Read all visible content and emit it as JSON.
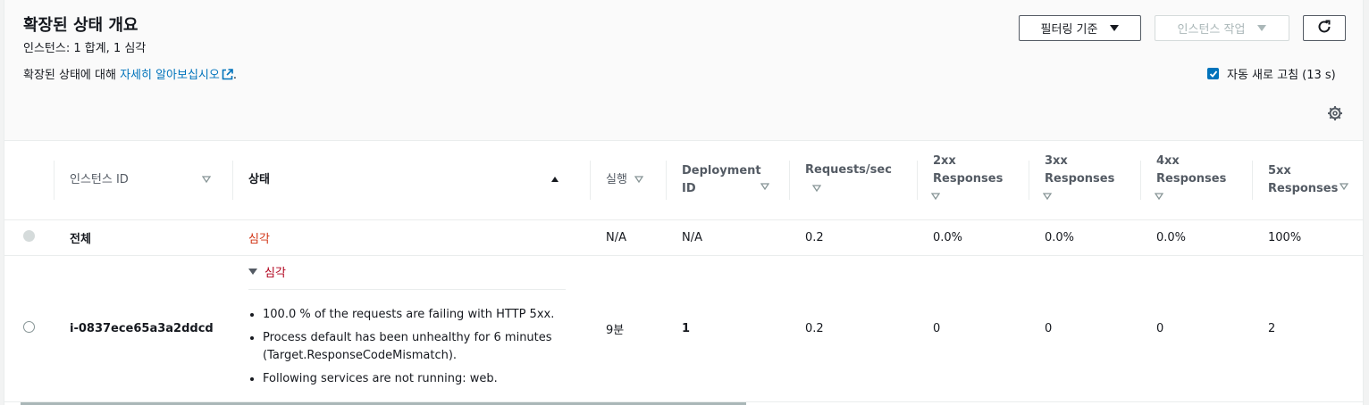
{
  "header": {
    "title": "확장된 상태 개요",
    "counter": "인스턴스: 1 합계, 1 심각",
    "description_prefix": "확장된 상태에 대해 ",
    "learn_more_link": "자세히 알아보십시오",
    "description_suffix": ".",
    "filter_button": "필터링 기준",
    "actions_button": "인스턴스 작업",
    "auto_refresh": "자동 새로 고침 (13 s)"
  },
  "table": {
    "columns": [
      {
        "label": ""
      },
      {
        "label": "인스턴스 ID"
      },
      {
        "label": "상태"
      },
      {
        "label": "실행"
      },
      {
        "label": "Deployment ID"
      },
      {
        "label": "Requests/sec"
      },
      {
        "label": "2xx Responses"
      },
      {
        "label": "3xx Responses"
      },
      {
        "label": "4xx Responses"
      },
      {
        "label": "5xx Responses"
      }
    ],
    "overall": {
      "id": "전체",
      "status": "심각",
      "running": "N/A",
      "deployment": "N/A",
      "rps": "0.2",
      "r2xx": "0.0%",
      "r3xx": "0.0%",
      "r4xx": "0.0%",
      "r5xx": "100%"
    },
    "instance": {
      "id": "i-0837ece65a3a2ddcd",
      "status": "심각",
      "causes": [
        "100.0 % of the requests are failing with HTTP 5xx.",
        "Process default has been unhealthy for 6 minutes (Target.ResponseCodeMismatch).",
        "Following services are not running: web."
      ],
      "running": "9분",
      "deployment": "1",
      "rps": "0.2",
      "r2xx": "0",
      "r3xx": "0",
      "r4xx": "0",
      "r5xx": "2"
    }
  },
  "colors": {
    "link": "#0073bb",
    "severe": "#d13212",
    "checkbox": "#0073bb"
  }
}
